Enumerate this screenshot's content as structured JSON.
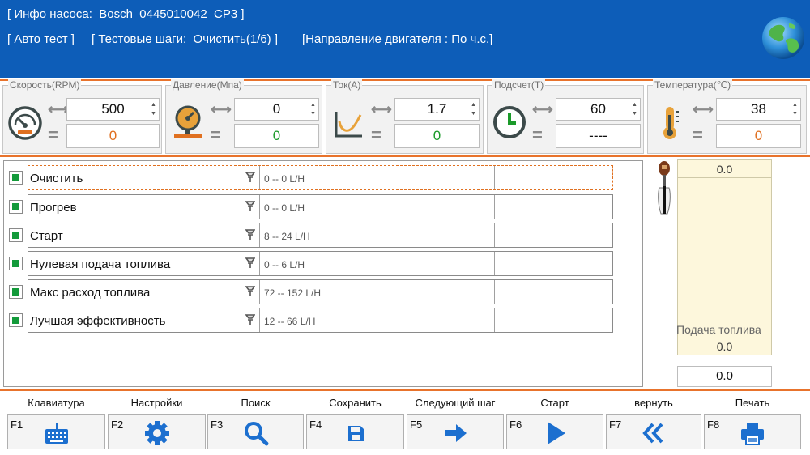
{
  "header": {
    "pump_info": "[ Инфо насоса:  Bosch  0445010042  CP3 ]",
    "auto_test": "[ Авто тест ]",
    "test_steps": "[ Тестовые шаги:  Очистить(1/6) ]",
    "engine_direction": "[Направление двигателя : По ч.с.]"
  },
  "colors": {
    "header_bg": "#0d5db8",
    "accent": "#e8732c",
    "status_green": "#139a3a",
    "actual_orange": "#e07020"
  },
  "gauges": [
    {
      "title": "Скорость(RPM)",
      "icon": "speedometer-icon",
      "set_value": "500",
      "actual_value": "0",
      "actual_color": "orange"
    },
    {
      "title": "Давление(Mпa)",
      "icon": "pressure-gauge-icon",
      "set_value": "0",
      "actual_value": "0",
      "actual_color": "green"
    },
    {
      "title": "Ток(A)",
      "icon": "current-curve-icon",
      "set_value": "1.7",
      "actual_value": "0",
      "actual_color": "green"
    },
    {
      "title": "Подсчет(T)",
      "icon": "clock-icon",
      "set_value": "60",
      "actual_value": "----",
      "actual_color": "dark"
    },
    {
      "title": "Температура(℃)",
      "icon": "thermometer-icon",
      "set_value": "38",
      "actual_value": "0",
      "actual_color": "orange"
    }
  ],
  "tests": [
    {
      "name": "Очистить",
      "range": "0 -- 0 L/H",
      "checked": true,
      "selected": true
    },
    {
      "name": "Прогрев",
      "range": "0 -- 0 L/H",
      "checked": true,
      "selected": false
    },
    {
      "name": "Старт",
      "range": "8 -- 24 L/H",
      "checked": true,
      "selected": false
    },
    {
      "name": "Нулевая подача топлива",
      "range": "0 -- 6 L/H",
      "checked": true,
      "selected": false
    },
    {
      "name": "Макс расход топлива",
      "range": "72 -- 152 L/H",
      "checked": true,
      "selected": false
    },
    {
      "name": "Лучшая эффективность",
      "range": "12 -- 66 L/H",
      "checked": true,
      "selected": false
    }
  ],
  "flow": {
    "top_value": "0.0",
    "label": "Подача топлива",
    "bottom_value": "0.0",
    "value": "0.0"
  },
  "function_keys": [
    {
      "key": "F1",
      "label": "Клавиатура",
      "icon": "keyboard-icon"
    },
    {
      "key": "F2",
      "label": "Настройки",
      "icon": "gear-icon"
    },
    {
      "key": "F3",
      "label": "Поиск",
      "icon": "search-icon"
    },
    {
      "key": "F4",
      "label": "Сохранить",
      "icon": "save-icon"
    },
    {
      "key": "F5",
      "label": "Следующий шаг",
      "icon": "arrow-right-icon"
    },
    {
      "key": "F6",
      "label": "Старт",
      "icon": "play-icon"
    },
    {
      "key": "F7",
      "label": "вернуть",
      "icon": "double-chevron-left-icon"
    },
    {
      "key": "F8",
      "label": "Печать",
      "icon": "printer-icon"
    }
  ]
}
